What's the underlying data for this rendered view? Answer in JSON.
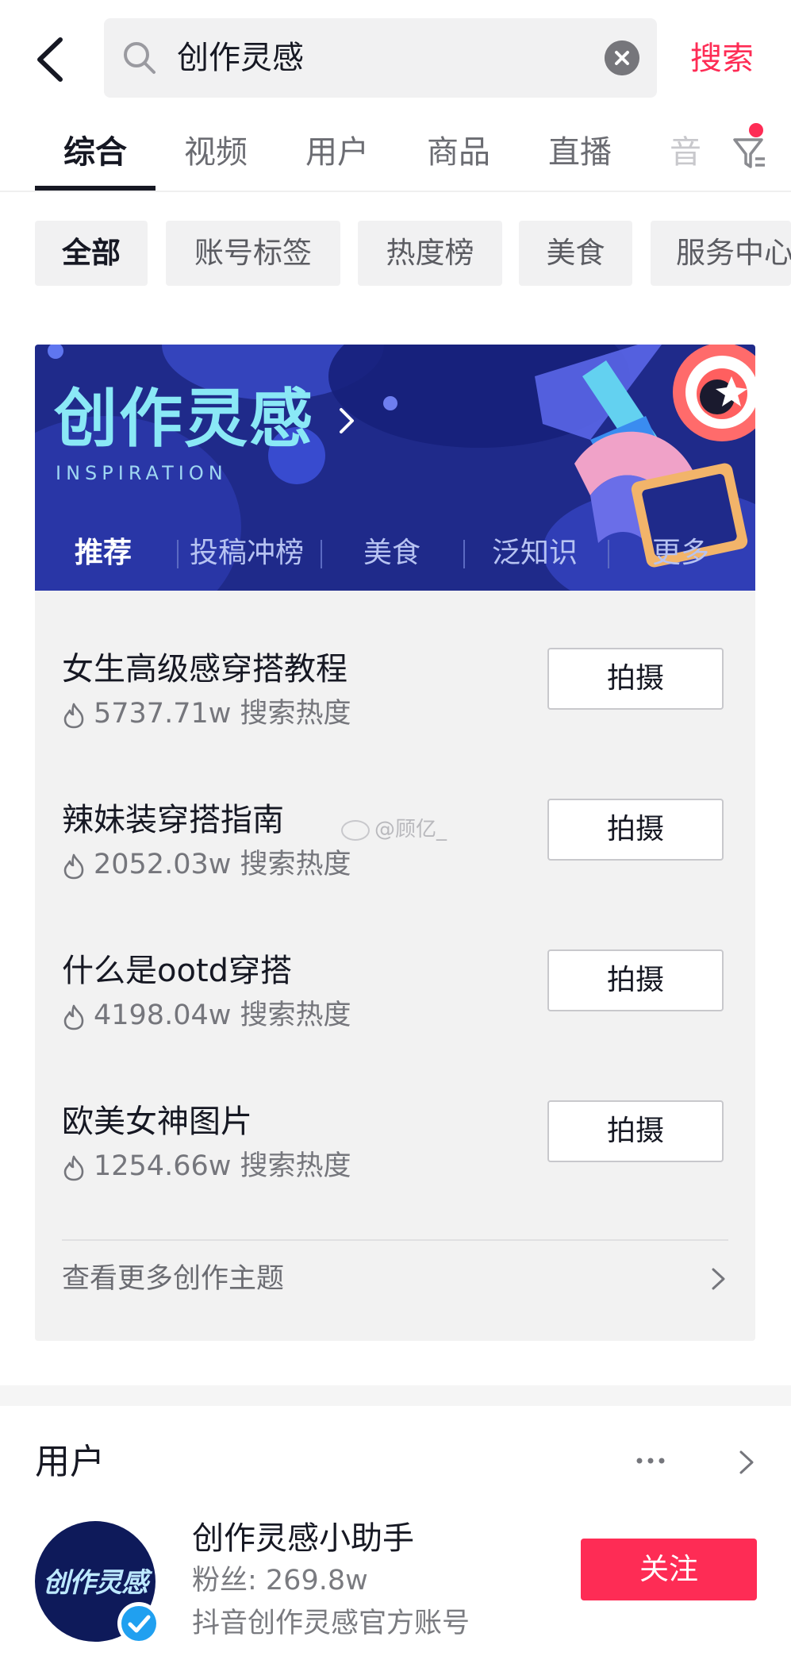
{
  "header": {
    "search_query": "创作灵感",
    "search_action": "搜索"
  },
  "tabs": [
    "综合",
    "视频",
    "用户",
    "商品",
    "直播",
    "音"
  ],
  "chips": [
    "全部",
    "账号标签",
    "热度榜",
    "美食",
    "服务中心"
  ],
  "inspiration": {
    "title": "创作灵感",
    "subtitle": "INSPIRATION",
    "tabs": [
      "推荐",
      "投稿冲榜",
      "美食",
      "泛知识",
      "更多"
    ],
    "topics": [
      {
        "title": "女生高级感穿搭教程",
        "heat": "5737.71w 搜索热度",
        "button": "拍摄"
      },
      {
        "title": "辣妹装穿搭指南",
        "heat": "2052.03w 搜索热度",
        "button": "拍摄"
      },
      {
        "title": "什么是ootd穿搭",
        "heat": "4198.04w 搜索热度",
        "button": "拍摄"
      },
      {
        "title": "欧美女神图片",
        "heat": "1254.66w 搜索热度",
        "button": "拍摄"
      }
    ],
    "more_link": "查看更多创作主题"
  },
  "users": {
    "title": "用户",
    "user": {
      "avatar_text": "创作灵感",
      "name": "创作灵感小助手",
      "fans": "粉丝: 269.8w",
      "desc": "抖音创作灵感官方账号",
      "follow": "关注"
    }
  },
  "watermark": "@顾亿_",
  "colors": {
    "accent": "#fe2c55",
    "banner_bg": "#1f2a8a",
    "card_bg": "#f2f2f2"
  }
}
